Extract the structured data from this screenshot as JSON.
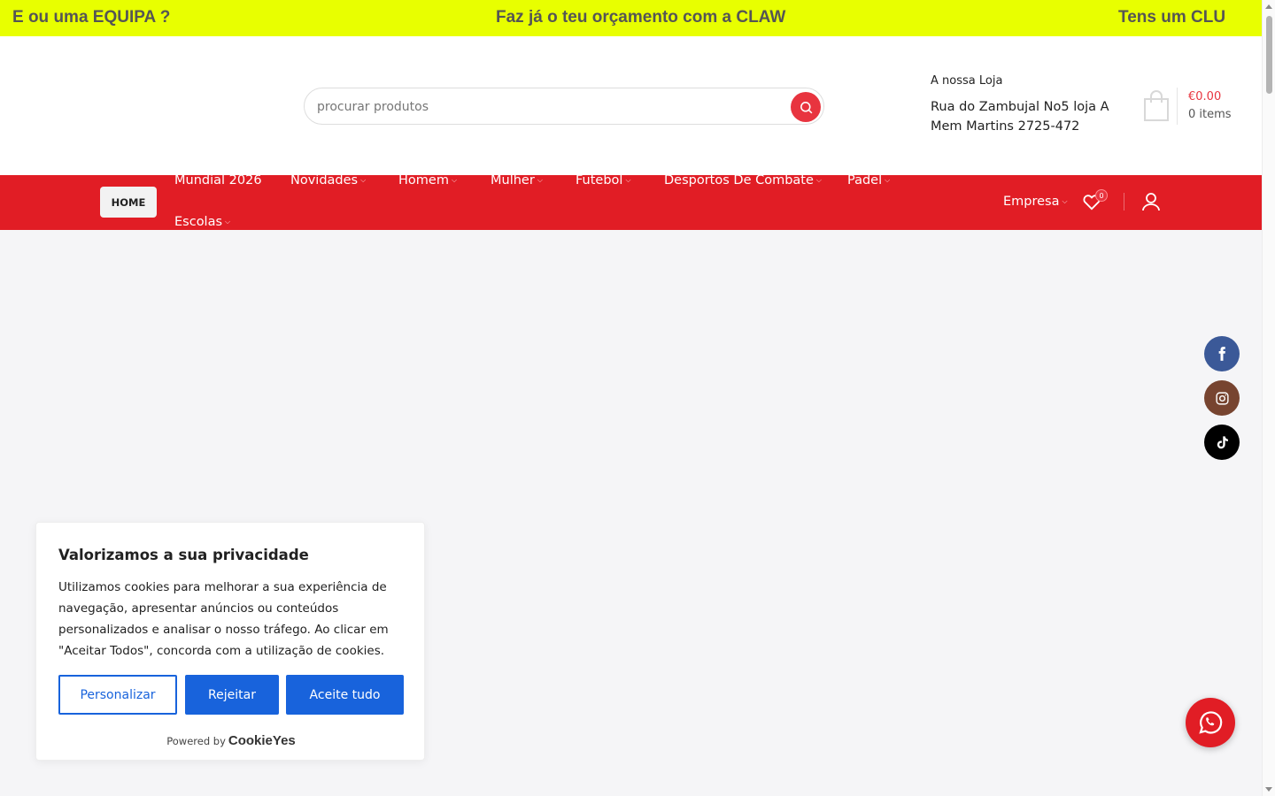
{
  "promo": {
    "msg1": "E ou uma EQUIPA ?",
    "msg2": "Faz já o teu orçamento com a CLAW",
    "msg3": "Tens um CLU"
  },
  "header": {
    "search_placeholder": "procurar produtos",
    "store_label": "A nossa Loja",
    "store_address": "Rua do Zambujal No5 loja A Mem Martins 2725-472",
    "cart_total": "€0.00",
    "cart_items": "0 items"
  },
  "nav": {
    "home": "HOME",
    "items": [
      {
        "label": "Mundial 2026"
      },
      {
        "label": "Novidades"
      },
      {
        "label": "Homem"
      },
      {
        "label": "Mulher"
      },
      {
        "label": "Futebol"
      },
      {
        "label": "Desportos De Combate"
      },
      {
        "label": "Padel"
      },
      {
        "label": "Escolas"
      }
    ],
    "empresa": "Empresa",
    "wishlist_count": "0"
  },
  "social": [
    "facebook-icon",
    "instagram-icon",
    "tiktok-icon"
  ],
  "cookie": {
    "title": "Valorizamos a sua privacidade",
    "text": "Utilizamos cookies para melhorar a sua experiência de navegação, apresentar anúncios ou conteúdos personalizados e analisar o nosso tráfego. Ao clicar em \"Aceitar Todos\", concorda com a utilização de cookies.",
    "customize": "Personalizar",
    "reject": "Rejeitar",
    "accept": "Aceite tudo",
    "powered_by": "Powered by",
    "brand": "CookieYes"
  },
  "colors": {
    "promo_bg": "#e8ff00",
    "nav_bg": "#e11d25",
    "accent": "#e8343f",
    "cookie_blue": "#1863dc"
  }
}
